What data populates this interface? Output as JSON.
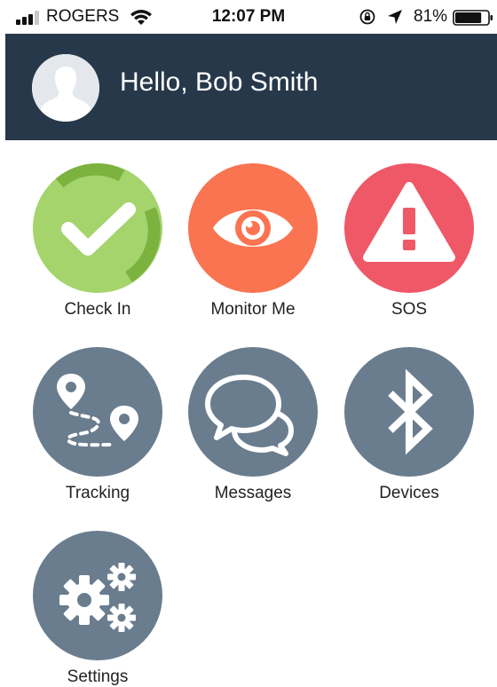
{
  "status_bar": {
    "carrier": "ROGERS",
    "time": "12:07 PM",
    "battery_percent": "81%",
    "battery_level": 0.81,
    "icons": [
      "signal-icon",
      "wifi-icon",
      "rotation-lock-icon",
      "location-arrow-icon",
      "battery-icon"
    ]
  },
  "header": {
    "greeting": "Hello, Bob Smith",
    "avatar_icon": "user-silhouette-icon"
  },
  "tiles": [
    {
      "label": "Check In",
      "icon": "checkmark-icon",
      "color": "#a4d46b"
    },
    {
      "label": "Monitor Me",
      "icon": "eye-icon",
      "color": "#fa7451"
    },
    {
      "label": "SOS",
      "icon": "warning-triangle-icon",
      "color": "#ee5867"
    },
    {
      "label": "Tracking",
      "icon": "route-pins-icon",
      "color": "#6a7d8e"
    },
    {
      "label": "Messages",
      "icon": "chat-bubbles-icon",
      "color": "#6a7d8e"
    },
    {
      "label": "Devices",
      "icon": "bluetooth-icon",
      "color": "#6a7d8e"
    },
    {
      "label": "Settings",
      "icon": "gears-icon",
      "color": "#6a7d8e"
    }
  ],
  "colors": {
    "header_bg": "#26384a",
    "accent_green": "#a4d46b",
    "accent_orange": "#fa7451",
    "accent_red": "#ee5867",
    "tile_gray": "#6a7d8e"
  }
}
